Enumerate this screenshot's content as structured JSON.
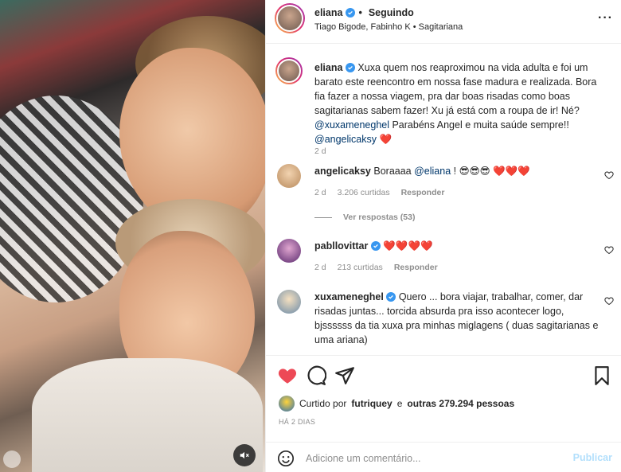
{
  "post": {
    "author": "eliana",
    "follow_status": "Seguindo",
    "separator": "•",
    "subtitle": "Tiago Bigode, Fabinho K • Sagitariana",
    "more_icon": "ellipsis-icon",
    "video_mute_icon": "speaker-muted-icon"
  },
  "caption": {
    "user": "eliana",
    "text_before": "Xuxa quem nos reaproximou na vida adulta e foi um barato este reencontro em nossa fase madura e realizada. Bora fia fazer a nossa viagem, pra dar boas risadas como boas sagitarianas sabem fazer! Xu já está com a roupa de ir! Né? ",
    "mention1": "@xuxameneghel",
    "text_middle": " Parabéns Angel e muita saúde sempre!! ",
    "mention2": "@angelicaksy",
    "heart": "❤️",
    "time": "2 d"
  },
  "comments": [
    {
      "user": "angelicaksy",
      "verified": false,
      "text_before": "Boraaaa ",
      "mention": "@eliana",
      "text_after": " ! 😎😎😎 ❤️❤️❤️",
      "time": "2 d",
      "likes": "3.206 curtidas",
      "reply": "Responder",
      "view_replies": "Ver respostas (53)"
    },
    {
      "user": "pabllovittar",
      "verified": true,
      "text": "❤️❤️❤️❤️",
      "time": "2 d",
      "likes": "213 curtidas",
      "reply": "Responder"
    },
    {
      "user": "xuxameneghel",
      "verified": true,
      "text": "Quero ... bora viajar, trabalhar, comer, dar risadas juntas... torcida absurda pra isso acontecer logo, bjssssss da tia xuxa pra minhas miglagens ( duas sagitarianas e uma ariana)"
    }
  ],
  "actions": {
    "like_icon": "heart-filled-icon",
    "comment_icon": "comment-icon",
    "share_icon": "paper-plane-icon",
    "save_icon": "bookmark-icon",
    "liked_by_prefix": "Curtido por",
    "liked_by_user": "futriquey",
    "liked_by_connector": "e",
    "liked_by_others": "outras 279.294 pessoas",
    "ago": "HÁ 2 DIAS"
  },
  "composer": {
    "placeholder": "Adicione um comentário...",
    "publish_label": "Publicar",
    "emoji_icon": "smiley-icon"
  },
  "colors": {
    "like_red": "#ed4956",
    "mention_blue": "#00376b",
    "verified_blue": "#3897f0",
    "publish_disabled": "#b2dffc"
  }
}
